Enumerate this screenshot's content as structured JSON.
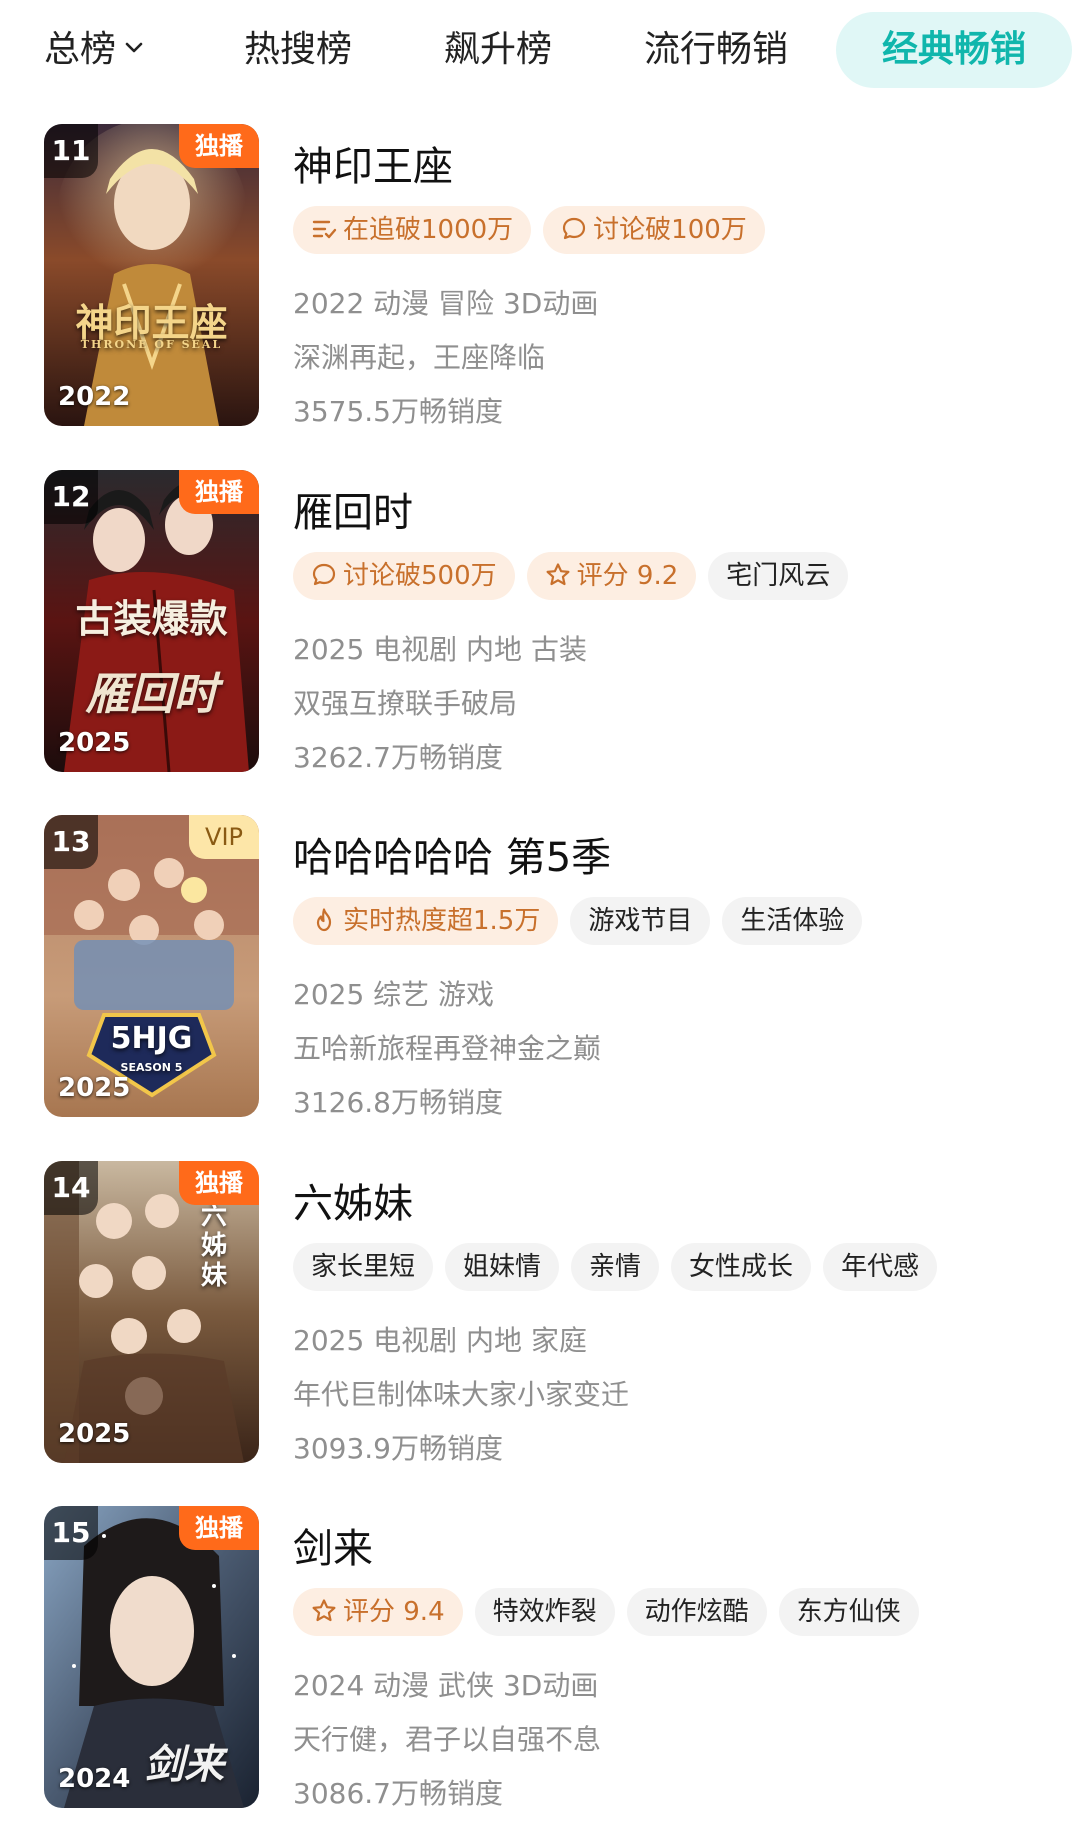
{
  "tabs": {
    "total": "总榜",
    "hot": "热搜榜",
    "rising": "飙升榜",
    "popular": "流行畅销",
    "classic": "经典畅销"
  },
  "items": [
    {
      "rank": "11",
      "badge": "独播",
      "year": "2022",
      "poster_text": "神印王座",
      "poster_sub": "THRONE OF SEAL",
      "title": "神印王座",
      "tags": [
        {
          "icon": "follow-list-icon",
          "text": "在追破1000万",
          "highlight": true
        },
        {
          "icon": "comment-icon",
          "text": "讨论破100万",
          "highlight": true
        }
      ],
      "info": "2022 动漫 冒险 3D动画",
      "desc": "深渊再起，王座降临",
      "sales": "3575.5万畅销度"
    },
    {
      "rank": "12",
      "badge": "独播",
      "year": "2025",
      "poster_text": "古装爆款",
      "poster_sub": "雁回时",
      "title": "雁回时",
      "tags": [
        {
          "icon": "comment-icon",
          "text": "讨论破500万",
          "highlight": true
        },
        {
          "icon": "star-icon",
          "text": "评分 9.2",
          "highlight": true
        },
        {
          "icon": "",
          "text": "宅门风云",
          "highlight": false
        }
      ],
      "info": "2025 电视剧 内地 古装",
      "desc": "双强互撩联手破局",
      "sales": "3262.7万畅销度"
    },
    {
      "rank": "13",
      "badge": "VIP",
      "year": "2025",
      "poster_text": "5HJG",
      "poster_sub": "SEASON 5",
      "title": "哈哈哈哈哈 第5季",
      "tags": [
        {
          "icon": "flame-icon",
          "text": "实时热度超1.5万",
          "highlight": true
        },
        {
          "icon": "",
          "text": "游戏节目",
          "highlight": false
        },
        {
          "icon": "",
          "text": "生活体验",
          "highlight": false
        }
      ],
      "info": "2025 综艺 游戏",
      "desc": "五哈新旅程再登神金之巅",
      "sales": "3126.8万畅销度"
    },
    {
      "rank": "14",
      "badge": "独播",
      "year": "2025",
      "poster_text": "六姊妹",
      "poster_sub": "",
      "title": "六姊妹",
      "tags": [
        {
          "icon": "",
          "text": "家长里短",
          "highlight": false
        },
        {
          "icon": "",
          "text": "姐妹情",
          "highlight": false
        },
        {
          "icon": "",
          "text": "亲情",
          "highlight": false
        },
        {
          "icon": "",
          "text": "女性成长",
          "highlight": false
        },
        {
          "icon": "",
          "text": "年代感",
          "highlight": false
        }
      ],
      "info": "2025 电视剧 内地 家庭",
      "desc": "年代巨制体味大家小家变迁",
      "sales": "3093.9万畅销度"
    },
    {
      "rank": "15",
      "badge": "独播",
      "year": "2024",
      "poster_text": "剑来",
      "poster_sub": "",
      "title": "剑来",
      "tags": [
        {
          "icon": "star-icon",
          "text": "评分 9.4",
          "highlight": true
        },
        {
          "icon": "",
          "text": "特效炸裂",
          "highlight": false
        },
        {
          "icon": "",
          "text": "动作炫酷",
          "highlight": false
        },
        {
          "icon": "",
          "text": "东方仙侠",
          "highlight": false
        }
      ],
      "info": "2024 动漫 武侠 3D动画",
      "desc": "天行健，君子以自强不息",
      "sales": "3086.7万畅销度"
    }
  ],
  "colors": {
    "accent": "#10b6ac",
    "accent_bg": "#e0f7f6",
    "exclusive_badge": "#ff6a1a",
    "vip_badge": "#fde6a8",
    "highlight_tag_bg": "#fdeee2",
    "highlight_tag_text": "#c8702c"
  }
}
